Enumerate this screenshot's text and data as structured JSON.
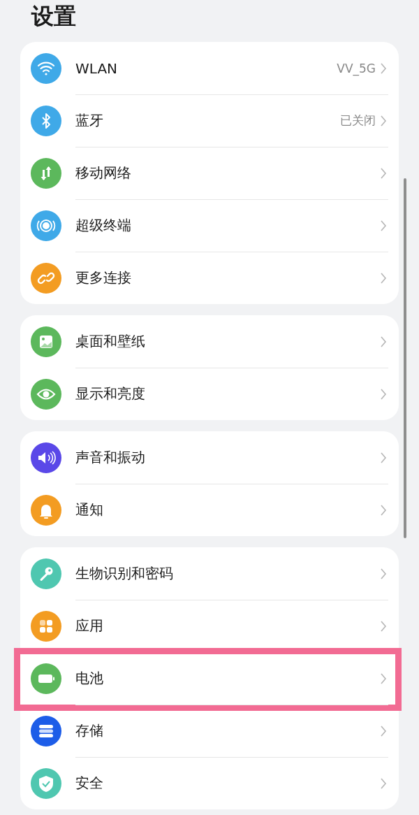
{
  "title": "设置",
  "groups": [
    {
      "items": [
        {
          "kind": "wifi",
          "color": "#3fa9e8",
          "label": "WLAN",
          "value": "VV_5G",
          "highlighted": false
        },
        {
          "kind": "bluetooth",
          "color": "#3fa9e8",
          "label": "蓝牙",
          "value": "已关闭",
          "highlighted": false
        },
        {
          "kind": "mobile-data",
          "color": "#5cb85c",
          "label": "移动网络",
          "highlighted": false
        },
        {
          "kind": "radar",
          "color": "#3fa9e8",
          "label": "超级终端",
          "highlighted": false
        },
        {
          "kind": "link",
          "color": "#f39c22",
          "label": "更多连接",
          "highlighted": false
        }
      ]
    },
    {
      "items": [
        {
          "kind": "image",
          "color": "#5cb85c",
          "label": "桌面和壁纸",
          "highlighted": false
        },
        {
          "kind": "eye",
          "color": "#5cb85c",
          "label": "显示和亮度",
          "highlighted": false
        }
      ]
    },
    {
      "items": [
        {
          "kind": "speaker",
          "color": "#5a48e8",
          "label": "声音和振动",
          "highlighted": false
        },
        {
          "kind": "bell",
          "color": "#f39c22",
          "label": "通知",
          "highlighted": false
        }
      ]
    },
    {
      "items": [
        {
          "kind": "key",
          "color": "#4fc7b0",
          "label": "生物识别和密码",
          "highlighted": false
        },
        {
          "kind": "apps",
          "color": "#f39c22",
          "label": "应用",
          "highlighted": false
        },
        {
          "kind": "battery",
          "color": "#5cb85c",
          "label": "电池",
          "highlighted": true
        },
        {
          "kind": "storage",
          "color": "#1d5de8",
          "label": "存储",
          "highlighted": false
        },
        {
          "kind": "shield",
          "color": "#4fc7b0",
          "label": "安全",
          "highlighted": false
        }
      ]
    }
  ]
}
